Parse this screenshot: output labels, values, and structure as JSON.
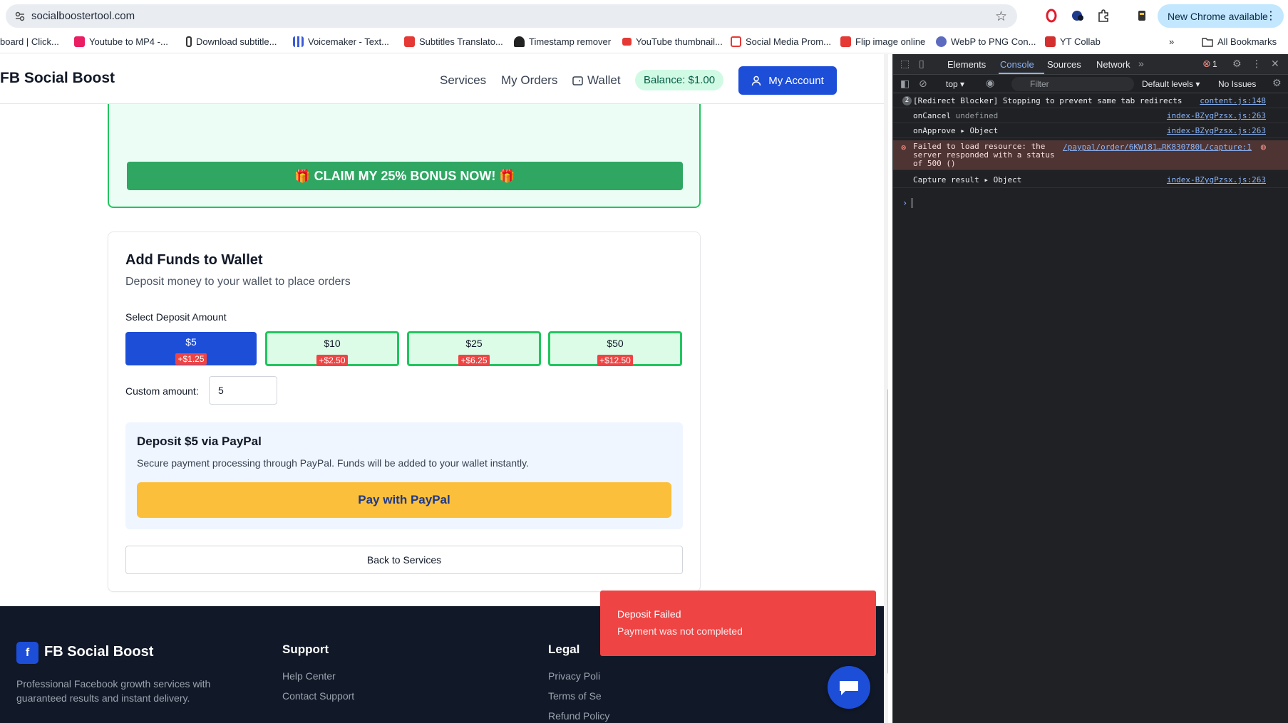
{
  "browser": {
    "url": "socialboostertool.com",
    "new_chrome_label": "New Chrome available",
    "bookmarks": [
      "board | Click...",
      "Youtube to MP4 -...",
      "Download subtitle...",
      "Voicemaker - Text...",
      "Subtitles Translato...",
      "Timestamp remover",
      "YouTube thumbnail...",
      "Social Media Prom...",
      "Flip image online",
      "WebP to PNG Con...",
      "YT Collab"
    ],
    "all_bookmarks_label": "All Bookmarks"
  },
  "site": {
    "brand": "FB Social Boost",
    "nav": {
      "services": "Services",
      "orders": "My Orders",
      "wallet": "Wallet",
      "balance": "Balance: $1.00",
      "account": "My Account"
    },
    "claim_label": "🎁 CLAIM MY 25% BONUS NOW! 🎁",
    "funds": {
      "title": "Add Funds to Wallet",
      "subtitle": "Deposit money to your wallet to place orders",
      "select_label": "Select Deposit Amount",
      "amounts": [
        {
          "value": "$5",
          "bonus": "+$1.25"
        },
        {
          "value": "$10",
          "bonus": "+$2.50"
        },
        {
          "value": "$25",
          "bonus": "+$6.25"
        },
        {
          "value": "$50",
          "bonus": "+$12.50"
        }
      ],
      "custom_label": "Custom amount:",
      "custom_value": "5",
      "paypal_title": "Deposit $5 via PayPal",
      "paypal_desc": "Secure payment processing through PayPal. Funds will be added to your wallet instantly.",
      "paypal_button": "Pay with PayPal",
      "back_button": "Back to Services"
    },
    "footer": {
      "brand": "FB Social Boost",
      "tagline": "Professional Facebook growth services with guaranteed results and instant delivery.",
      "support_heading": "Support",
      "support_links": [
        "Help Center",
        "Contact Support"
      ],
      "legal_heading": "Legal",
      "legal_links": [
        "Privacy Poli",
        "Terms of Se",
        "Refund Policy"
      ]
    },
    "toast": {
      "title": "Deposit Failed",
      "message": "Payment was not completed"
    }
  },
  "devtools": {
    "tabs": [
      "Elements",
      "Console",
      "Sources",
      "Network"
    ],
    "error_count": "1",
    "context": "top ▾",
    "filter_placeholder": "Filter",
    "levels": "Default levels ▾",
    "issues": "No Issues",
    "logs": [
      {
        "badge": "2",
        "text": "[Redirect Blocker] Stopping to prevent same tab redirects",
        "source": "content.js:148"
      },
      {
        "text": "onCancel",
        "extra": "undefined",
        "source": "index-BZygPzsx.js:263"
      },
      {
        "text": "onApprove",
        "extra": "▸ Object",
        "source": "index-BZygPzsx.js:263"
      },
      {
        "text": "Failed to load resource: the server responded with a status of 500 ()",
        "source": "/paypal/order/6KW181…RK830780L/capture:1"
      },
      {
        "text": "Capture result",
        "extra": "▸ Object",
        "source": "index-BZygPzsx.js:263"
      }
    ]
  },
  "colors": {
    "primary": "#1d4ed8",
    "success": "#22c55e",
    "danger": "#ef4444",
    "paypal": "#fbbf3c"
  }
}
